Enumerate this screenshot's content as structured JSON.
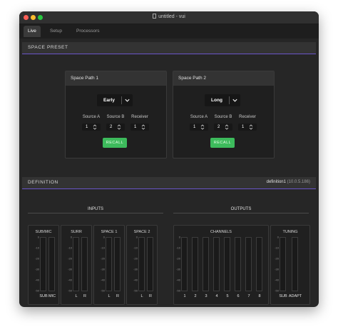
{
  "window": {
    "title": "untitled - vui"
  },
  "tabs": [
    {
      "label": "Live"
    },
    {
      "label": "Setup"
    },
    {
      "label": "Processors"
    }
  ],
  "space_preset": {
    "header": "SPACE PRESET",
    "paths": [
      {
        "title": "Space Path 1",
        "preset": "Early",
        "source_a": "1",
        "source_b": "2",
        "receiver": "1",
        "recall": "RECALL"
      },
      {
        "title": "Space Path 2",
        "preset": "Long",
        "source_a": "1",
        "source_b": "2",
        "receiver": "1",
        "recall": "RECALL"
      }
    ],
    "field_labels": {
      "source_a": "Source A",
      "source_b": "Source B",
      "receiver": "Receiver"
    }
  },
  "definition": {
    "header": "DEFINITION",
    "device": "definition1",
    "ip": "(10.0.5.186)"
  },
  "inputs": {
    "title": "INPUTS",
    "groups": [
      {
        "title": "SUB/MIC",
        "channels": [
          "SUB",
          "MIC"
        ]
      },
      {
        "title": "SURR",
        "channels": [
          "L",
          "R"
        ]
      },
      {
        "title": "SPACE 1",
        "channels": [
          "L",
          "R"
        ]
      },
      {
        "title": "SPACE 2",
        "channels": [
          "L",
          "R"
        ]
      }
    ]
  },
  "outputs": {
    "title": "OUTPUTS",
    "groups": [
      {
        "title": "CHANNELS",
        "channels": [
          "1",
          "2",
          "3",
          "4",
          "5",
          "6",
          "7",
          "8"
        ]
      },
      {
        "title": "TUNING",
        "channels": [
          "SUB",
          "ADAPT"
        ]
      }
    ]
  },
  "meter_scale": [
    "0",
    "-10",
    "-20",
    "-30",
    "-40",
    "-50"
  ],
  "colors": {
    "accent": "#6a55c9",
    "recall": "#3dbb5c",
    "background": "#262626"
  }
}
